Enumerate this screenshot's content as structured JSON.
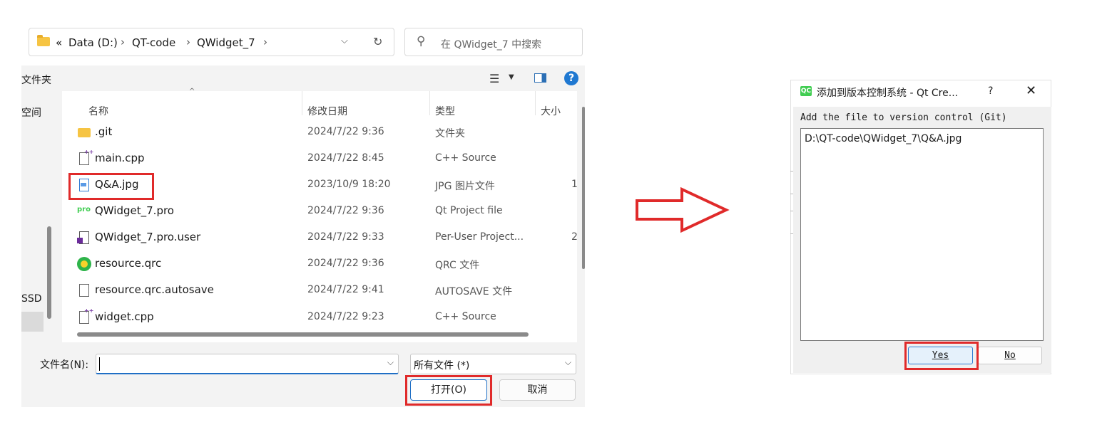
{
  "file_dialog": {
    "breadcrumbs": [
      "Data (D:)",
      "QT-code",
      "QWidget_7"
    ],
    "breadcrumb_prefix": "«",
    "search_placeholder": "在 QWidget_7 中搜索",
    "toolbar_left_label": "文件夹",
    "nav_items": [
      "空间",
      "SSD"
    ],
    "columns": {
      "name": "名称",
      "date": "修改日期",
      "type": "类型",
      "size": "大小"
    },
    "files": [
      {
        "name": ".git",
        "date": "2024/7/22 9:36",
        "type": "文件夹",
        "size": "",
        "icon": "folder-icon"
      },
      {
        "name": "main.cpp",
        "date": "2024/7/22 8:45",
        "type": "C++ Source",
        "size": "",
        "icon": "cpp-file-icon"
      },
      {
        "name": "Q&A.jpg",
        "date": "2023/10/9 18:20",
        "type": "JPG 图片文件",
        "size": "1",
        "icon": "jpg-file-icon"
      },
      {
        "name": "QWidget_7.pro",
        "date": "2024/7/22 9:36",
        "type": "Qt Project file",
        "size": "",
        "icon": "pro-file-icon"
      },
      {
        "name": "QWidget_7.pro.user",
        "date": "2024/7/22 9:33",
        "type": "Per-User Project...",
        "size": "2",
        "icon": "user-file-icon"
      },
      {
        "name": "resource.qrc",
        "date": "2024/7/22 9:36",
        "type": "QRC 文件",
        "size": "",
        "icon": "qrc-file-icon"
      },
      {
        "name": "resource.qrc.autosave",
        "date": "2024/7/22 9:41",
        "type": "AUTOSAVE 文件",
        "size": "",
        "icon": "generic-file-icon"
      },
      {
        "name": "widget.cpp",
        "date": "2024/7/22 9:23",
        "type": "C++ Source",
        "size": "",
        "icon": "cpp-file-icon"
      }
    ],
    "filename_label": "文件名(N):",
    "filename_value": "",
    "filetype_value": "所有文件 (*)",
    "open_button": "打开(O)",
    "cancel_button": "取消",
    "highlight_color": "#e02a2a"
  },
  "qt_dialog": {
    "title": "添加到版本控制系统 - Qt Cre...",
    "help": "?",
    "close": "✕",
    "logo_text": "QC",
    "prompt": "Add the file to version control (Git)",
    "file_path": "D:\\QT-code\\QWidget_7\\Q&A.jpg",
    "yes_button": "Yes",
    "no_button": "No"
  }
}
